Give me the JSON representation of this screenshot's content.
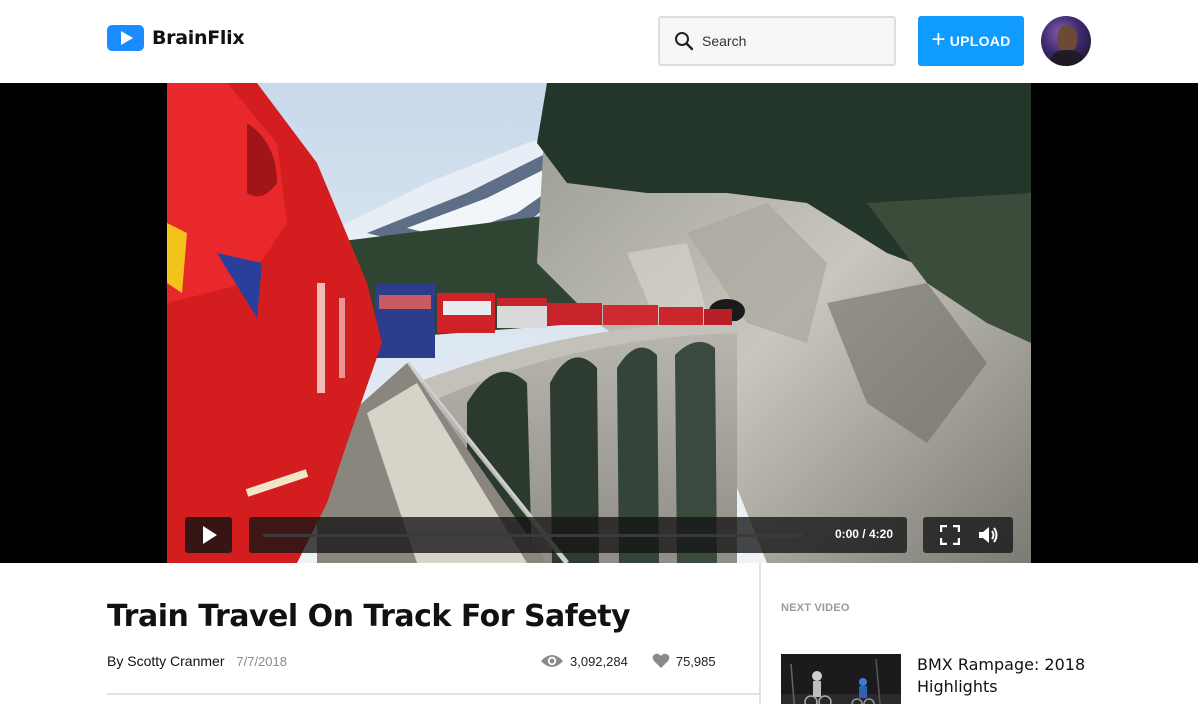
{
  "header": {
    "brand": "BrainFlix",
    "logo_icon": "play-logo-icon",
    "search_placeholder": "Search",
    "search_icon": "search-icon",
    "upload_label": "UPLOAD",
    "upload_icon": "plus-icon",
    "avatar_icon": "user-avatar"
  },
  "colors": {
    "brand_blue": "#0f9bff",
    "progress_blue": "#1a8cff",
    "muted_text": "#8a8a8a",
    "divider": "#e2e2e2"
  },
  "player": {
    "current_time": "0:00",
    "duration": "4:20",
    "time_display": "0:00 / 4:20",
    "progress_fraction": 0,
    "play_icon": "play-icon",
    "fullscreen_icon": "fullscreen-icon",
    "volume_icon": "volume-icon"
  },
  "video": {
    "title": "Train Travel On Track For Safety",
    "by_label": "By",
    "author": "Scotty Cranmer",
    "date": "7/7/2018",
    "views": "3,092,284",
    "likes": "75,985",
    "views_icon": "eye-icon",
    "likes_icon": "heart-icon"
  },
  "sidebar": {
    "next_label": "NEXT VIDEO",
    "next_videos": [
      {
        "title": "BMX Rampage: 2018 Highlights"
      }
    ]
  }
}
